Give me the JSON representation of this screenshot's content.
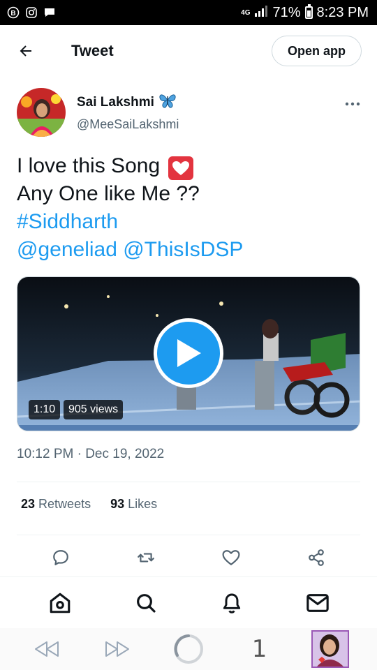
{
  "status_bar": {
    "network": "4G",
    "battery": "71%",
    "time": "8:23 PM"
  },
  "header": {
    "title": "Tweet",
    "open_app_label": "Open app"
  },
  "author": {
    "name": "Sai Lakshmi",
    "handle": "@MeeSaiLakshmi"
  },
  "tweet": {
    "line1": "I love this Song",
    "line2": "Any One like Me ??",
    "hashtag": "#Siddharth",
    "mentions": "@geneliad @ThisIsDSP"
  },
  "media": {
    "duration": "1:10",
    "views": "905 views"
  },
  "timestamp": "10:12 PM · Dec 19, 2022",
  "stats": {
    "retweets_count": "23",
    "retweets_label": "Retweets",
    "likes_count": "93",
    "likes_label": "Likes"
  },
  "browser": {
    "tab_count": "1"
  },
  "colors": {
    "accent": "#1d9bf0",
    "text": "#0f1419",
    "muted": "#536471"
  }
}
